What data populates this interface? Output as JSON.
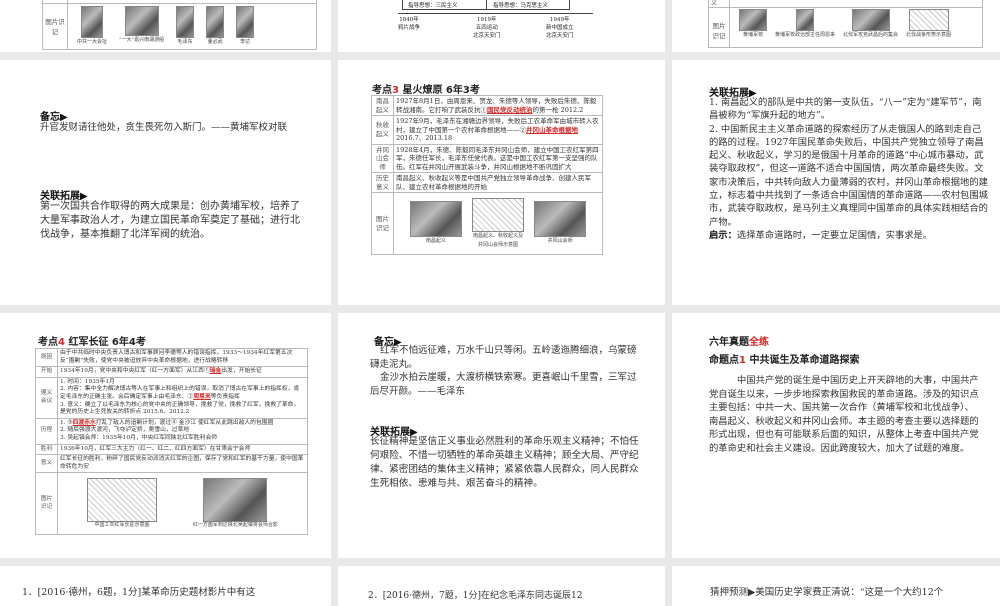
{
  "top_left": {
    "label": "图片识记",
    "captions": [
      "中共一大会址",
      "“一大”嘉兴南湖游船",
      "毛泽东",
      "董必武",
      "李达"
    ]
  },
  "top_mid": {
    "guide1": "指导思想：三民主义",
    "guide2": "指导思想：马克思主义",
    "t1": "1840年",
    "t1b": "鸦片战争",
    "t2": "1919年",
    "t2b": "五四运动",
    "t2c": "北京天安门",
    "t3": "1949年",
    "t3b": "新中国成立",
    "t3c": "北京天安门"
  },
  "top_right": {
    "label": "图片识记",
    "row_label": "义",
    "captions": [
      "黄埔军校",
      "黄埔军校政治部主任周恩来",
      "北伐军攻克武昌后的集会",
      "北伐战争形势示意图"
    ]
  },
  "s1": {
    "memo_h": "备忘▶",
    "memo": "升官发财请往他处，贪生畏死勿入斯门。——黄埔军校对联",
    "ext_h": "关联拓展▶",
    "ext": "第一次国共合作取得的两大成果是：创办黄埔军校，培养了大量军事政治人才，为建立国民革命军奠定了基础；进行北伐战争，基本推翻了北洋军阀的统治。"
  },
  "s2": {
    "title_a": "考点",
    "title_n": "3",
    "title_b": "星火燎原  6年3考",
    "rows": [
      {
        "k": "南昌起义",
        "a": "1927年8月1日，由周恩来、贺龙、朱德等人领导，失败后朱德、陈毅转战湘南。它打响了武装反抗①",
        "b": "国民党反动统治",
        "c": "的第一枪 2012.2"
      },
      {
        "k": "秋收起义",
        "a": "1927年9月，毛泽东在湘赣边界领导，失败后工农革命军由城市转入农村，建立了中国第一个农村革命根据地——②",
        "b": "井冈山革命根据地",
        "c": " 2016.7、2013.18"
      },
      {
        "k": "井冈山会师",
        "a": "1928年4月，朱德、陈毅同毛泽东井冈山会师，建立中国工农红军第四军，朱德任军长，毛泽东任党代表。这是中国工农红军第一支坚强的队伍。红军在井冈山开展武装斗争，井冈山根据地不断巩固扩大",
        "b": "",
        "c": ""
      },
      {
        "k": "历史意义",
        "a": "南昌起义、秋收起义等是中国共产党独立领导革命战争、创建人民军队、建立农村革命根据地的开始",
        "b": "",
        "c": ""
      }
    ],
    "pic_label": "图片识记",
    "captions": [
      "南昌起义",
      "南昌起义、秋收起义及井冈山会师示意图",
      "井冈山会师"
    ]
  },
  "s3": {
    "ext_h": "关联拓展▶",
    "p1": "1. 南昌起义的部队是中共的第一支队伍，“八一”定为“建军节”，南昌被称为“军旗升起的地方”。",
    "p2": "2. 中国新民主主义革命道路的探索经历了从走俄国人的路到走自己的路的过程。1927年国民革命失败后，中国共产党独立领导了南昌起义、秋收起义，学习的是俄国十月革命的道路“中心城市暴动，武装夺取政权”，但这一道路不适合中国国情，两次革命最终失败。文家市决策后，中共转向敌人力量薄弱的农村，井冈山革命根据地的建立，标志着中共找到了一条适合中国国情的革命道路——农村包围城市，武装夺取政权，是马列主义真理同中国革命的具体实践相结合的产物。",
    "hint_h": "启示：",
    "hint": "选择革命道路时，一定要立足国情，实事求是。"
  },
  "s4": {
    "title_a": "考点",
    "title_n": "4",
    "title_b": "红军长征  6年4考",
    "rows": [
      {
        "k": "原因",
        "t": "由于中共临时中央负责人博古和军事顾问李德等人的错误指挥，1933～1934年红军第五次反“围剿”失败，使党中央被迫放弃中央革命根据地，进行战略转移"
      },
      {
        "k": "开始",
        "t": "1934年10月，党中央和中央红军（红一方面军）从江西①",
        "b": "瑞金",
        "c": "出发，开始长征"
      },
      {
        "k": "遵义会议",
        "t": "1. 时间：1935年1月\n2. 内容：集中全力解决博古等人在军事上和组织上的错误，取消了博古在军事上的指挥权，肯定毛泽东的正确主张。会后确定军事上由毛泽东、②",
        "b": "周恩来",
        "c": "等负责指挥\n3. 意义：确立了以毛泽东为核心的党中央的正确领导，挽救了党，挽救了红军，挽救了革命，是党的历史上生死攸关的转折点 2015.6、2012.2"
      },
      {
        "k": "历程",
        "t": "1. ③",
        "b": "四渡赤水",
        "c": "打乱了敌人的追剿计划，渡过④ 金沙江 使红军从此跳出敌人的包围圈\n2. 随后强渡大渡河，飞夺泸定桥，爬雪山，过草地\n3. 吴起镇会师：1935年10月，中央红军同陕北红军胜利会师"
      },
      {
        "k": "胜利",
        "t": "1936年10月，红军三大主力（红一、红二、红四方面军）在甘肃会宁会师"
      },
      {
        "k": "意义",
        "t": "红军长征的胜利，粉碎了国民党反动派消灭红军的企图，保存了党和红军的基干力量，使中国革命转危为安"
      }
    ],
    "pic_label": "图片识记",
    "captions": [
      "中国工农红军长征示意图",
      "红一方面军到达陕北吴起镇将会师合影"
    ]
  },
  "s5": {
    "memo_h": "备忘▶",
    "poem1": "红军不怕远征难，万水千山只等闲。五岭逶迤腾细浪，乌蒙磅礴走泥丸。",
    "poem2": "金沙水拍云崖暖，大渡桥横铁索寒。更喜岷山千里雪，三军过后尽开颜。——毛泽东",
    "ext_h": "关联拓展▶",
    "ext": "长征精神是坚信正义事业必然胜利的革命乐观主义精神；不怕任何艰险、不惜一切牺牲的革命英雄主义精神；顾全大局、严守纪律、紧密团结的集体主义精神；紧紧依靠人民群众，同人民群众生死相依、患难与共、艰苦奋斗的精神。"
  },
  "s6": {
    "h_a": "六年真题",
    "h_b": "全练",
    "sub_a": "命题点",
    "sub_n": "1",
    "sub_b": "中共诞生及革命道路探索",
    "body": "中国共产党的诞生是中国历史上开天辟地的大事，中国共产党自诞生以来，一步步地探索救国救民的革命道路。涉及的知识点主要包括：中共一大、国共第一次合作（黄埔军校和北伐战争）、南昌起义、秋收起义和井冈山会师。本主题的考查主要以选择题的形式出现，但也有可能联系后面的知识，从整体上考查中国共产党的革命史和社会主义建设。因此跨度较大，加大了试题的难度。"
  },
  "bottom": {
    "b1": "1．[2016·德州，6题，1分]某革命历史题材影片中有这",
    "b2": "2．[2016·德州，7题，1分]在纪念毛泽东同志诞辰12",
    "b3": "猜押预测▶美国历史学家费正清说：“这是一个大约12个"
  }
}
